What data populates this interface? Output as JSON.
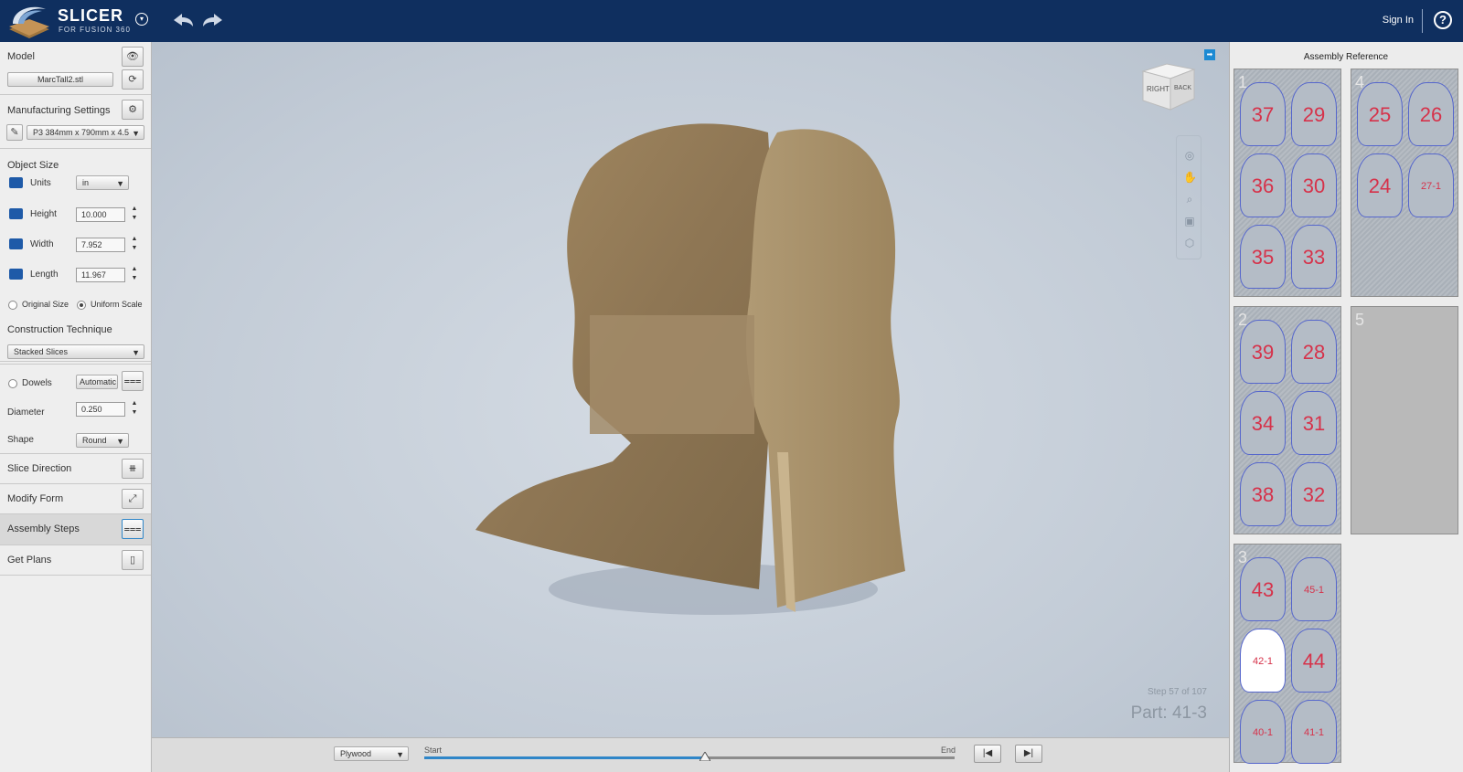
{
  "app": {
    "brand": "SLICER",
    "subtitle": "FOR FUSION 360",
    "signin": "Sign In",
    "help": "?"
  },
  "left": {
    "model": {
      "title": "Model",
      "file": "MarcTall2.stl"
    },
    "manufacturing": {
      "title": "Manufacturing Settings",
      "preset": "P3 384mm x 790mm x 4.5"
    },
    "object_size": {
      "title": "Object Size",
      "units_label": "Units",
      "units_value": "in",
      "height_label": "Height",
      "height_value": "10.000",
      "width_label": "Width",
      "width_value": "7.952",
      "length_label": "Length",
      "length_value": "11.967",
      "original_label": "Original Size",
      "uniform_label": "Uniform Scale"
    },
    "technique": {
      "title": "Construction Technique",
      "value": "Stacked Slices"
    },
    "dowels": {
      "label": "Dowels",
      "mode": "Automatic",
      "diameter_label": "Diameter",
      "diameter_value": "0.250",
      "shape_label": "Shape",
      "shape_value": "Round"
    },
    "slice_direction": "Slice Direction",
    "modify_form": "Modify Form",
    "assembly_steps": "Assembly Steps",
    "get_plans": "Get Plans"
  },
  "viewport": {
    "cube_right": "RIGHT",
    "cube_back": "BACK",
    "step": "Step 57 of 107",
    "part": "Part: 41-3"
  },
  "bottom": {
    "material": "Plywood",
    "start": "Start",
    "end": "End",
    "progress": 0.53
  },
  "assembly": {
    "title": "Assembly Reference",
    "sheets": [
      {
        "num": "1",
        "labels": [
          "37",
          "29",
          "36",
          "30",
          "35",
          "33"
        ]
      },
      {
        "num": "4",
        "labels": [
          "25",
          "26",
          "24",
          "27-1"
        ]
      },
      {
        "num": "2",
        "labels": [
          "39",
          "28",
          "34",
          "31",
          "38",
          "32"
        ]
      },
      {
        "num": "5",
        "labels": []
      },
      {
        "num": "3",
        "labels": [
          "43",
          "45-1",
          "42-1",
          "44",
          "40-1",
          "41-1"
        ]
      }
    ]
  }
}
